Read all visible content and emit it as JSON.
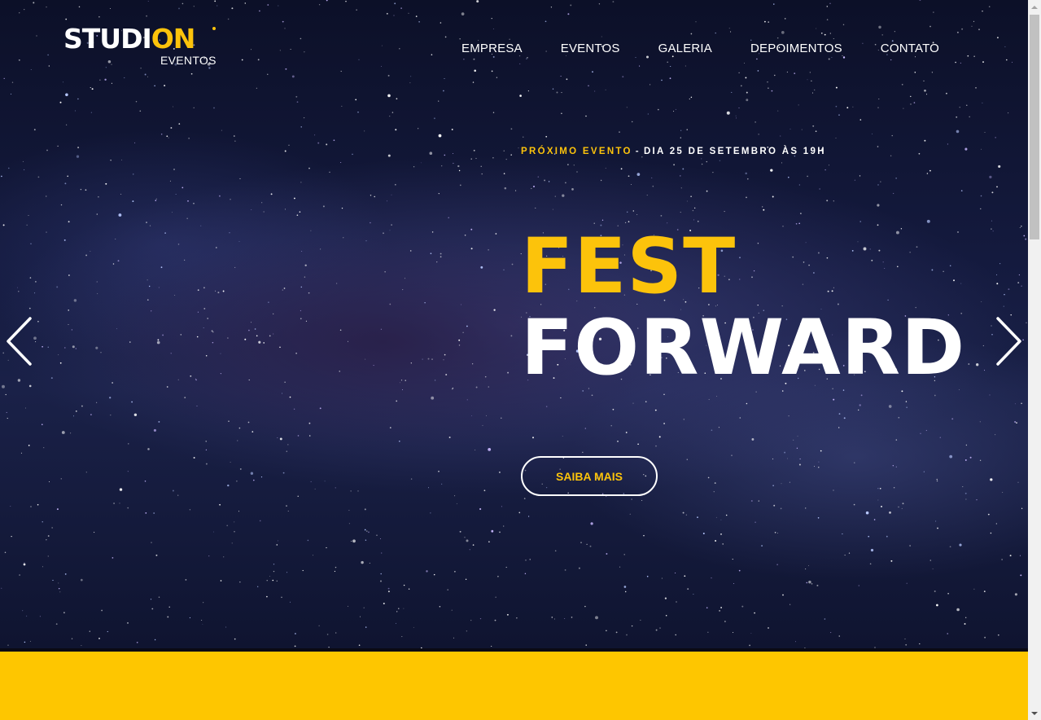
{
  "brand": {
    "name_part1": "STUDI",
    "name_part2": "ON",
    "subtitle": "EVENTOS"
  },
  "nav": {
    "items": [
      "EMPRESA",
      "EVENTOS",
      "GALERIA",
      "DEPOIMENTOS",
      "CONTATO"
    ]
  },
  "hero": {
    "next_event_label": "PRÓXIMO EVENTO",
    "separator": "-",
    "next_event_date": "DIA 25 DE SETEMBRO ÀS 19H",
    "title_line1": "FEST",
    "title_line2": "FORWARD",
    "cta_label": "SAIBA MAIS"
  },
  "icons": {
    "prev": "chevron-left-icon",
    "next": "chevron-right-icon"
  },
  "colors": {
    "accent": "#fcc30b",
    "hero_bg": "#141a3e",
    "section_yellow": "#fec600"
  }
}
